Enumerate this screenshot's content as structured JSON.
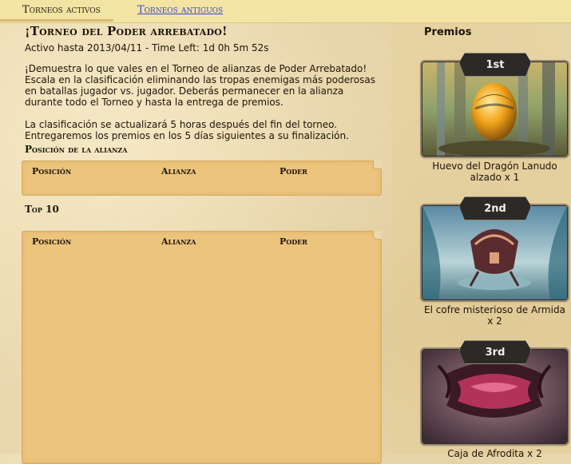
{
  "tabs": {
    "active": "Torneos activos",
    "old": "Torneos antiguos"
  },
  "tournament": {
    "title": "¡Torneo del Poder arrebatado!",
    "active_line": "Activo hasta 2013/04/11 - Time Left: 1d 0h 5m 52s",
    "description_1": "¡Demuestra lo que vales en el Torneo de alianzas de Poder Arrebatado! Escala en la clasificación eliminando las tropas enemigas más poderosas en batallas jugador vs. jugador. Deberás permanecer en la alianza durante todo el Torneo y hasta la entrega de premios.",
    "description_2": "La clasificación se actualizará 5 horas después del fin del torneo. Entregaremos los premios en los 5 días siguientes a su finalización."
  },
  "alliance_position": {
    "title": "Posición de la alianza",
    "columns": [
      "Posición",
      "Alianza",
      "Poder"
    ]
  },
  "top10": {
    "title": "Top 10",
    "columns": [
      "Posición",
      "Alianza",
      "Poder"
    ]
  },
  "sidebar": {
    "title": "Premios",
    "prizes": [
      {
        "rank": "1st",
        "name": "Huevo del Dragón Lanudo alzado  x 1",
        "icon": "dragon-egg-icon"
      },
      {
        "rank": "2nd",
        "name": "El cofre misterioso de Armida  x 2",
        "icon": "mystery-chest-icon"
      },
      {
        "rank": "3rd",
        "name": "Caja de Afrodita  x 2",
        "icon": "aphrodite-box-icon"
      }
    ]
  },
  "colors": {
    "tab_bar": "#f3e4a4",
    "link": "#3747c9",
    "panel": "#ecc47d",
    "rank_badge": "#2b2a26"
  }
}
